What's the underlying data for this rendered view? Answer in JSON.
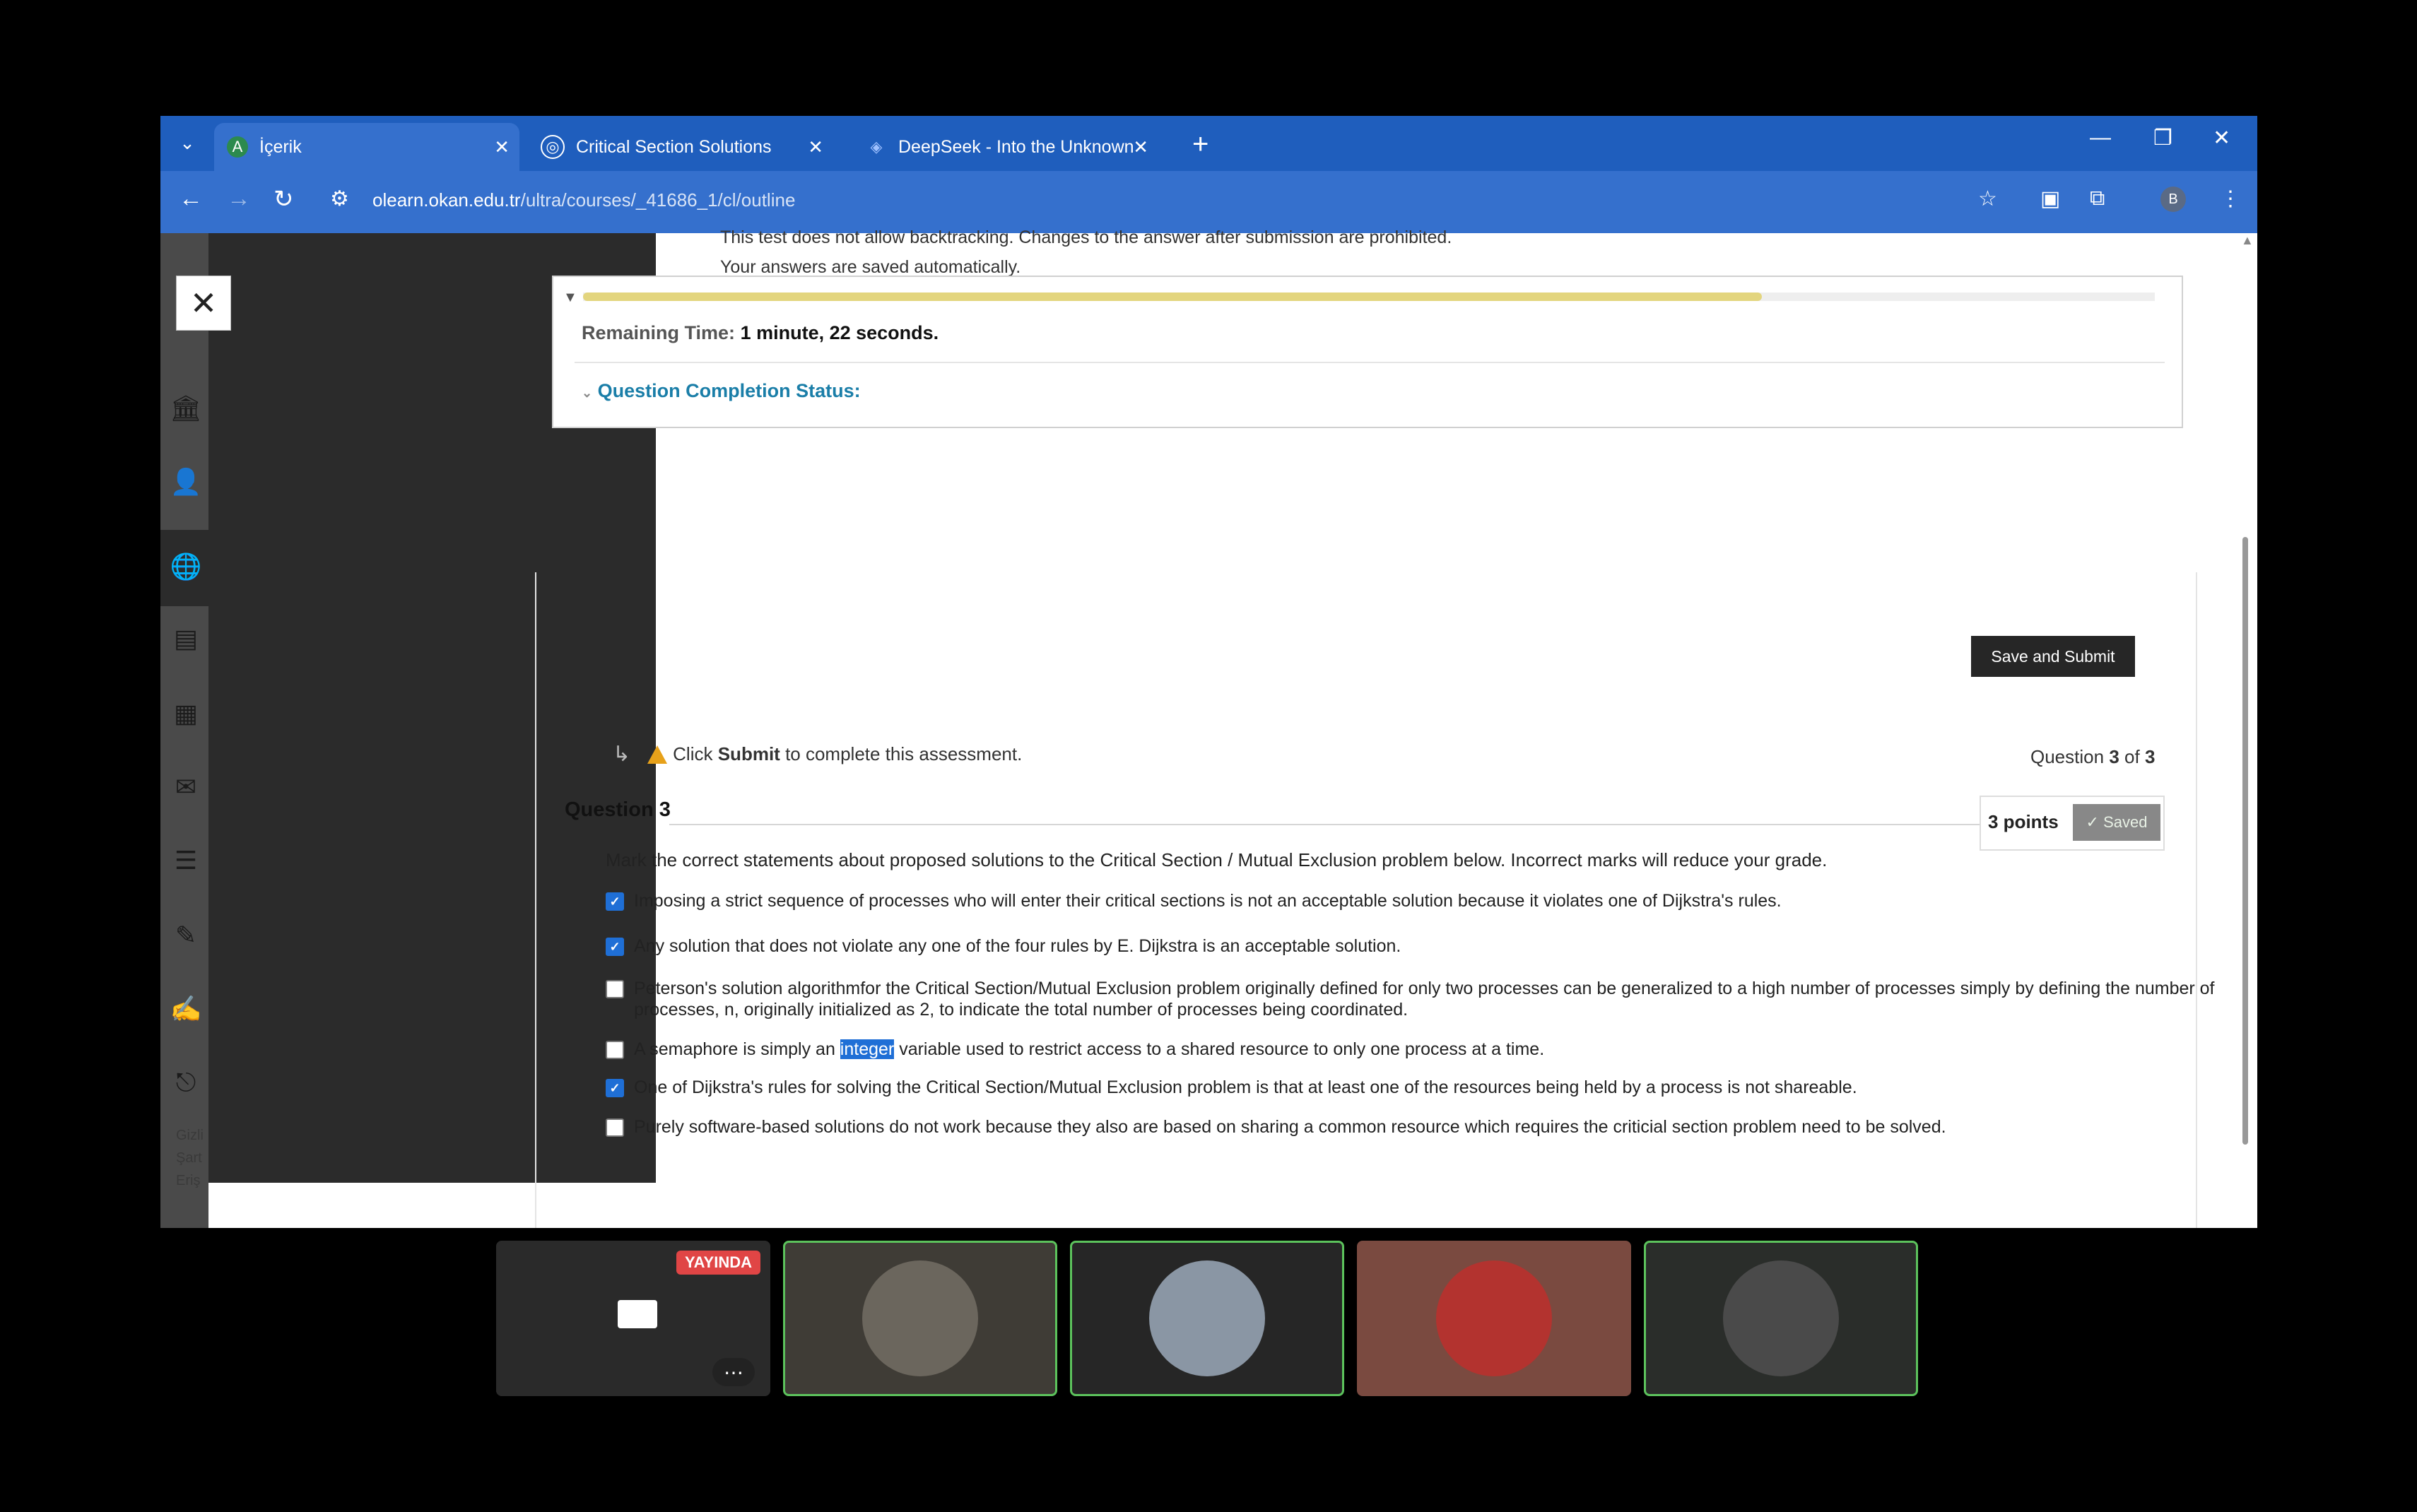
{
  "browser": {
    "tabs": [
      {
        "title": "İçerik",
        "favicon": "A"
      },
      {
        "title": "Critical Section Solutions",
        "favicon": "◎"
      },
      {
        "title": "DeepSeek - Into the Unknown",
        "favicon": "◈"
      }
    ],
    "url_host": "olearn.okan.edu.tr",
    "url_path": "/ultra/courses/_41686_1/cl/outline",
    "profile_initial": "B"
  },
  "test": {
    "note_backtracking": "This test does not allow backtracking. Changes to the answer after submission are prohibited.",
    "note_saved": "Your answers are saved automatically.",
    "remaining_label": "Remaining Time:",
    "remaining_value": "1 minute, 22 seconds.",
    "progress_fraction": 0.75,
    "completion_label": "Question Completion Status:",
    "save_submit_label": "Save and Submit",
    "click_label": "Click",
    "submit_word": "Submit",
    "to_complete": "to complete this assessment.",
    "question_prefix": "Question",
    "question_current": "3",
    "question_of": "of",
    "question_total": "3"
  },
  "question": {
    "title": "Question 3",
    "points": "3 points",
    "saved": "Saved",
    "prompt": "Mark the correct statements about proposed solutions to the Critical Section / Mutual Exclusion problem below. Incorrect marks will reduce your grade.",
    "options": [
      {
        "checked": true,
        "text": "Imposing a strict sequence of processes who will enter their critical sections is not an acceptable solution because it violates one of Dijkstra's rules."
      },
      {
        "checked": true,
        "text": "Any solution that does not violate any one of the four rules by E. Dijkstra is an acceptable solution."
      },
      {
        "checked": false,
        "text": "Peterson's solution algorithmfor the Critical Section/Mutual Exclusion problem originally defined for only two processes can be generalized to a high number of processes simply by defining the number of processes, n, originally initialized as 2, to indicate the total number of processes being coordinated."
      },
      {
        "checked": false,
        "text_before": "A semaphore is simply an ",
        "text_highlight": "integer",
        "text_after": " variable used to restrict access to a shared resource to only one process at a time."
      },
      {
        "checked": true,
        "text": "One of Dijkstra's rules for solving the Critical Section/Mutual Exclusion problem is that at least one of the resources being held by a process is not shareable."
      },
      {
        "checked": false,
        "text": "Purely software-based solutions do not work because they also are based on sharing a common resource which requires the criticial section problem need to be solved."
      }
    ]
  },
  "sidebar_footer": [
    "Gizli",
    "Şart",
    "Eriş"
  ],
  "meeting": {
    "live_label": "YAYINDA",
    "tile_colors": [
      "#1e1e1e",
      "#3f3c36",
      "#262626",
      "#7a4a40",
      "#2a2d2a"
    ]
  }
}
